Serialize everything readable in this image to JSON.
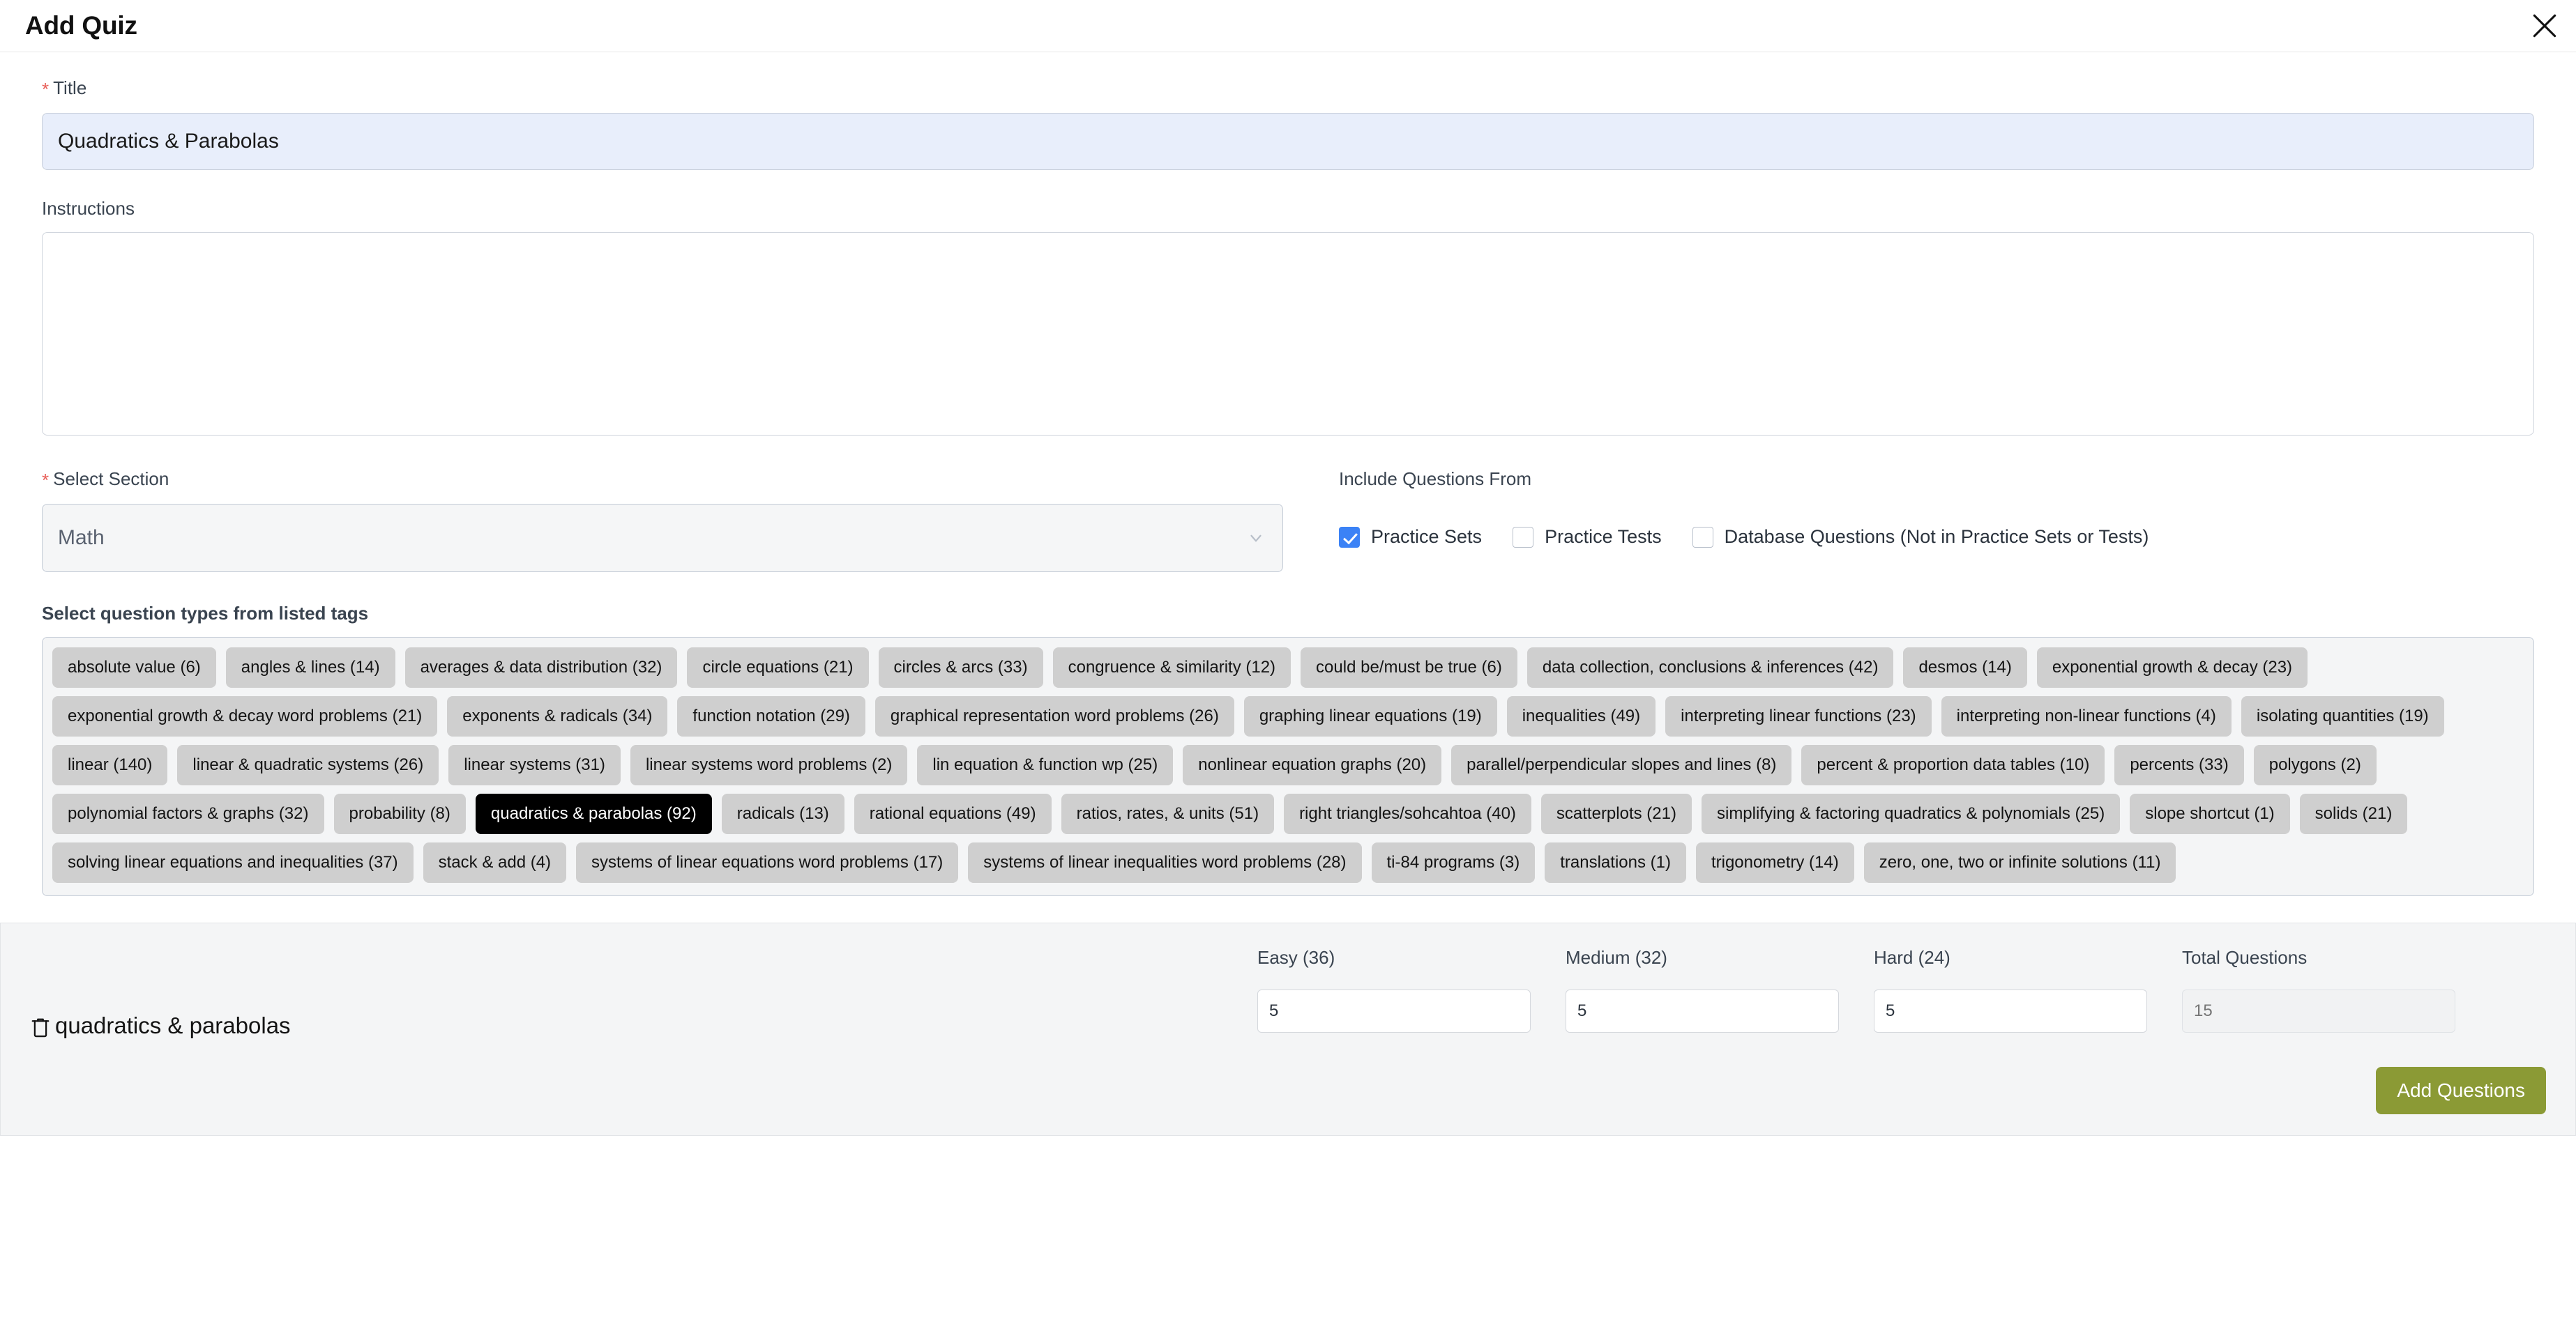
{
  "header": {
    "title": "Add Quiz",
    "close_icon": "close-icon"
  },
  "form": {
    "title_field": {
      "label": "Title",
      "required_marker": "*",
      "value": "Quadratics & Parabolas",
      "placeholder": ""
    },
    "instructions_field": {
      "label": "Instructions",
      "value": "",
      "placeholder": ""
    },
    "section_field": {
      "label": "Select Section",
      "required_marker": "*",
      "value": "Math",
      "caret_icon": "chevron-down-icon"
    },
    "include_from": {
      "label": "Include Questions From",
      "options": [
        {
          "label": "Practice Sets",
          "checked": true
        },
        {
          "label": "Practice Tests",
          "checked": false
        },
        {
          "label": "Database Questions (Not in Practice Sets or Tests)",
          "checked": false
        }
      ]
    }
  },
  "tags_section": {
    "heading": "Select question types from listed tags",
    "tags": [
      {
        "label": "absolute value (6)",
        "selected": false
      },
      {
        "label": "angles & lines (14)",
        "selected": false
      },
      {
        "label": "averages & data distribution (32)",
        "selected": false
      },
      {
        "label": "circle equations (21)",
        "selected": false
      },
      {
        "label": "circles & arcs (33)",
        "selected": false
      },
      {
        "label": "congruence & similarity (12)",
        "selected": false
      },
      {
        "label": "could be/must be true (6)",
        "selected": false
      },
      {
        "label": "data collection, conclusions & inferences (42)",
        "selected": false
      },
      {
        "label": "desmos (14)",
        "selected": false
      },
      {
        "label": "exponential growth & decay (23)",
        "selected": false
      },
      {
        "label": "exponential growth & decay word problems (21)",
        "selected": false
      },
      {
        "label": "exponents & radicals (34)",
        "selected": false
      },
      {
        "label": "function notation (29)",
        "selected": false
      },
      {
        "label": "graphical representation word problems (26)",
        "selected": false
      },
      {
        "label": "graphing linear equations (19)",
        "selected": false
      },
      {
        "label": "inequalities (49)",
        "selected": false
      },
      {
        "label": "interpreting linear functions (23)",
        "selected": false
      },
      {
        "label": "interpreting non-linear functions (4)",
        "selected": false
      },
      {
        "label": "isolating quantities (19)",
        "selected": false
      },
      {
        "label": "linear (140)",
        "selected": false
      },
      {
        "label": "linear & quadratic systems (26)",
        "selected": false
      },
      {
        "label": "linear systems (31)",
        "selected": false
      },
      {
        "label": "linear systems word problems (2)",
        "selected": false
      },
      {
        "label": "lin equation & function wp (25)",
        "selected": false
      },
      {
        "label": "nonlinear equation graphs (20)",
        "selected": false
      },
      {
        "label": "parallel/perpendicular slopes and lines (8)",
        "selected": false
      },
      {
        "label": "percent & proportion data tables (10)",
        "selected": false
      },
      {
        "label": "percents (33)",
        "selected": false
      },
      {
        "label": "polygons (2)",
        "selected": false
      },
      {
        "label": "polynomial factors & graphs (32)",
        "selected": false
      },
      {
        "label": "probability (8)",
        "selected": false
      },
      {
        "label": "quadratics & parabolas (92)",
        "selected": true
      },
      {
        "label": "radicals (13)",
        "selected": false
      },
      {
        "label": "rational equations (49)",
        "selected": false
      },
      {
        "label": "ratios, rates, & units (51)",
        "selected": false
      },
      {
        "label": "right triangles/sohcahtoa (40)",
        "selected": false
      },
      {
        "label": "scatterplots (21)",
        "selected": false
      },
      {
        "label": "simplifying & factoring quadratics & polynomials (25)",
        "selected": false
      },
      {
        "label": "slope shortcut (1)",
        "selected": false
      },
      {
        "label": "solids (21)",
        "selected": false
      },
      {
        "label": "solving linear equations and inequalities (37)",
        "selected": false
      },
      {
        "label": "stack & add (4)",
        "selected": false
      },
      {
        "label": "systems of linear equations word problems (17)",
        "selected": false
      },
      {
        "label": "systems of linear inequalities word problems (28)",
        "selected": false
      },
      {
        "label": "ti-84 programs (3)",
        "selected": false
      },
      {
        "label": "translations (1)",
        "selected": false
      },
      {
        "label": "trigonometry (14)",
        "selected": false
      },
      {
        "label": "zero, one, two or infinite solutions (11)",
        "selected": false
      }
    ]
  },
  "builder": {
    "row": {
      "delete_icon": "trash-icon",
      "tag_name": "quadratics & parabolas",
      "easy_label": "Easy (36)",
      "easy_value": "5",
      "medium_label": "Medium (32)",
      "medium_value": "5",
      "hard_label": "Hard (24)",
      "hard_value": "5",
      "total_label": "Total Questions",
      "total_placeholder": "15"
    },
    "add_questions_label": "Add Questions"
  },
  "colors": {
    "accent_green": "#8b9a35",
    "checkbox_blue": "#3b82f6",
    "required_red": "#e8605a",
    "tag_selected_bg": "#000000",
    "tag_bg": "#cfcfcf",
    "title_input_bg": "#e8eefb"
  }
}
